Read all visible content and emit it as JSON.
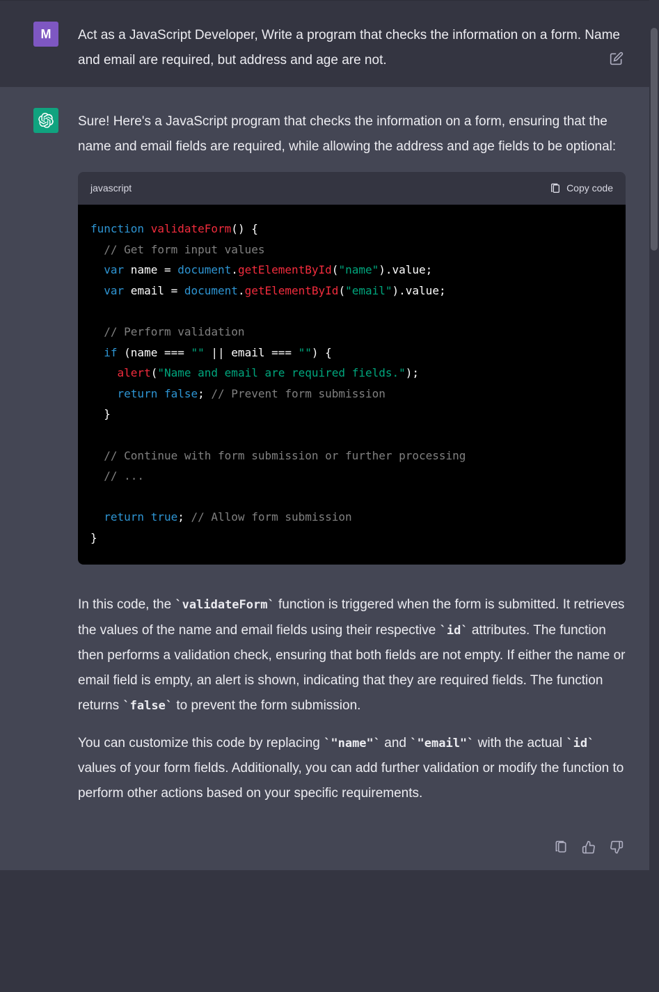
{
  "user": {
    "avatar_letter": "M",
    "message": "Act as a JavaScript Developer, Write a program that checks the information on a form. Name and email are required, but address and age are not."
  },
  "assistant": {
    "intro": "Sure! Here's a JavaScript program that checks the information on a form, ensuring that the name and email fields are required, while allowing the address and age fields to be optional:",
    "code_language": "javascript",
    "copy_label": "Copy code",
    "code_tokens": [
      [
        {
          "t": "function",
          "c": "kw"
        },
        {
          "t": " "
        },
        {
          "t": "validateForm",
          "c": "fn"
        },
        {
          "t": "("
        },
        {
          "t": ") {"
        }
      ],
      [
        {
          "t": "  "
        },
        {
          "t": "// Get form input values",
          "c": "cmt"
        }
      ],
      [
        {
          "t": "  "
        },
        {
          "t": "var",
          "c": "kw"
        },
        {
          "t": " name = "
        },
        {
          "t": "document",
          "c": "obj"
        },
        {
          "t": "."
        },
        {
          "t": "getElementById",
          "c": "call"
        },
        {
          "t": "("
        },
        {
          "t": "\"name\"",
          "c": "str"
        },
        {
          "t": ").value;"
        }
      ],
      [
        {
          "t": "  "
        },
        {
          "t": "var",
          "c": "kw"
        },
        {
          "t": " email = "
        },
        {
          "t": "document",
          "c": "obj"
        },
        {
          "t": "."
        },
        {
          "t": "getElementById",
          "c": "call"
        },
        {
          "t": "("
        },
        {
          "t": "\"email\"",
          "c": "str"
        },
        {
          "t": ").value;"
        }
      ],
      [],
      [
        {
          "t": "  "
        },
        {
          "t": "// Perform validation",
          "c": "cmt"
        }
      ],
      [
        {
          "t": "  "
        },
        {
          "t": "if",
          "c": "kw"
        },
        {
          "t": " (name === "
        },
        {
          "t": "\"\"",
          "c": "str"
        },
        {
          "t": " || email === "
        },
        {
          "t": "\"\"",
          "c": "str"
        },
        {
          "t": ") {"
        }
      ],
      [
        {
          "t": "    "
        },
        {
          "t": "alert",
          "c": "call"
        },
        {
          "t": "("
        },
        {
          "t": "\"Name and email are required fields.\"",
          "c": "str"
        },
        {
          "t": ");"
        }
      ],
      [
        {
          "t": "    "
        },
        {
          "t": "return",
          "c": "kw"
        },
        {
          "t": " "
        },
        {
          "t": "false",
          "c": "bool"
        },
        {
          "t": "; "
        },
        {
          "t": "// Prevent form submission",
          "c": "cmt"
        }
      ],
      [
        {
          "t": "  }"
        }
      ],
      [],
      [
        {
          "t": "  "
        },
        {
          "t": "// Continue with form submission or further processing",
          "c": "cmt"
        }
      ],
      [
        {
          "t": "  "
        },
        {
          "t": "// ...",
          "c": "cmt"
        }
      ],
      [],
      [
        {
          "t": "  "
        },
        {
          "t": "return",
          "c": "kw"
        },
        {
          "t": " "
        },
        {
          "t": "true",
          "c": "bool"
        },
        {
          "t": "; "
        },
        {
          "t": "// Allow form submission",
          "c": "cmt"
        }
      ],
      [
        {
          "t": "}"
        }
      ]
    ],
    "explain1_parts": [
      {
        "t": "In this code, the "
      },
      {
        "t": "`validateForm`",
        "code": true
      },
      {
        "t": " function is triggered when the form is submitted. It retrieves the values of the name and email fields using their respective "
      },
      {
        "t": "`id`",
        "code": true
      },
      {
        "t": " attributes. The function then performs a validation check, ensuring that both fields are not empty. If either the name or email field is empty, an alert is shown, indicating that they are required fields. The function returns "
      },
      {
        "t": "`false`",
        "code": true
      },
      {
        "t": " to prevent the form submission."
      }
    ],
    "explain2_parts": [
      {
        "t": "You can customize this code by replacing "
      },
      {
        "t": "`\"name\"`",
        "code": true
      },
      {
        "t": " and "
      },
      {
        "t": "`\"email\"`",
        "code": true
      },
      {
        "t": " with the actual "
      },
      {
        "t": "`id`",
        "code": true
      },
      {
        "t": " values of your form fields. Additionally, you can add further validation or modify the function to perform other actions based on your specific requirements."
      }
    ]
  },
  "icons": {
    "edit": "edit-icon",
    "clipboard": "clipboard-icon",
    "thumbs_up": "thumbs-up-icon",
    "thumbs_down": "thumbs-down-icon"
  }
}
